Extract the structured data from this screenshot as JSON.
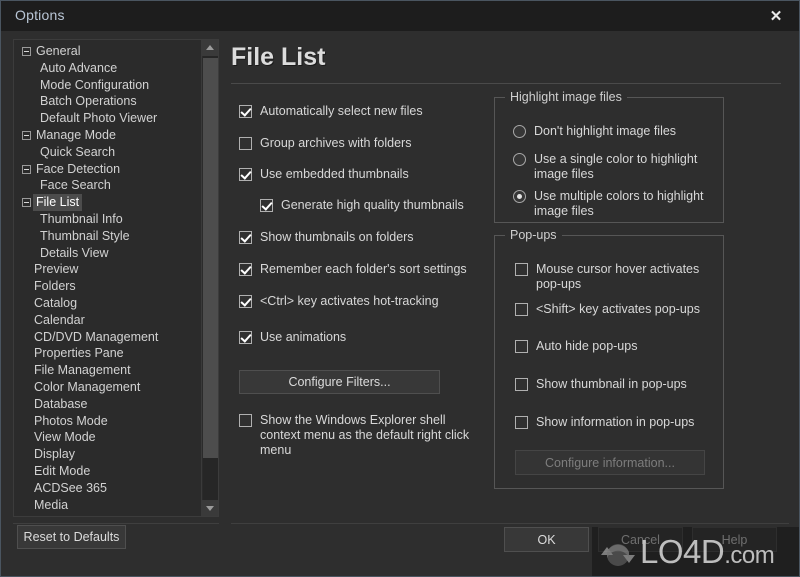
{
  "window": {
    "title": "Options",
    "close_icon": "close-icon"
  },
  "sidebar": {
    "items": [
      {
        "label": "General",
        "level": 0,
        "expandable": true,
        "selected": false
      },
      {
        "label": "Auto Advance",
        "level": 1,
        "expandable": false,
        "selected": false
      },
      {
        "label": "Mode Configuration",
        "level": 1,
        "expandable": false,
        "selected": false
      },
      {
        "label": "Batch Operations",
        "level": 1,
        "expandable": false,
        "selected": false
      },
      {
        "label": "Default Photo Viewer",
        "level": 1,
        "expandable": false,
        "selected": false
      },
      {
        "label": "Manage Mode",
        "level": 0,
        "expandable": true,
        "selected": false
      },
      {
        "label": "Quick Search",
        "level": 1,
        "expandable": false,
        "selected": false
      },
      {
        "label": "Face Detection",
        "level": 0,
        "expandable": true,
        "selected": false
      },
      {
        "label": "Face Search",
        "level": 1,
        "expandable": false,
        "selected": false
      },
      {
        "label": "File List",
        "level": 0,
        "expandable": true,
        "selected": true
      },
      {
        "label": "Thumbnail Info",
        "level": 1,
        "expandable": false,
        "selected": false
      },
      {
        "label": "Thumbnail Style",
        "level": 1,
        "expandable": false,
        "selected": false
      },
      {
        "label": "Details View",
        "level": 1,
        "expandable": false,
        "selected": false
      },
      {
        "label": "Preview",
        "level": 2,
        "expandable": false,
        "selected": false
      },
      {
        "label": "Folders",
        "level": 2,
        "expandable": false,
        "selected": false
      },
      {
        "label": "Catalog",
        "level": 2,
        "expandable": false,
        "selected": false
      },
      {
        "label": "Calendar",
        "level": 2,
        "expandable": false,
        "selected": false
      },
      {
        "label": "CD/DVD Management",
        "level": 2,
        "expandable": false,
        "selected": false
      },
      {
        "label": "Properties Pane",
        "level": 2,
        "expandable": false,
        "selected": false
      },
      {
        "label": "File Management",
        "level": 2,
        "expandable": false,
        "selected": false
      },
      {
        "label": "Color Management",
        "level": 2,
        "expandable": false,
        "selected": false
      },
      {
        "label": "Database",
        "level": 2,
        "expandable": false,
        "selected": false
      },
      {
        "label": "Photos Mode",
        "level": 2,
        "expandable": false,
        "selected": false
      },
      {
        "label": "View Mode",
        "level": 2,
        "expandable": false,
        "selected": false
      },
      {
        "label": "Display",
        "level": 2,
        "expandable": false,
        "selected": false
      },
      {
        "label": "Edit Mode",
        "level": 2,
        "expandable": false,
        "selected": false
      },
      {
        "label": "ACDSee 365",
        "level": 2,
        "expandable": false,
        "selected": false
      },
      {
        "label": "Media",
        "level": 2,
        "expandable": false,
        "selected": false
      }
    ],
    "scroll_up_icon": "chevron-up-icon",
    "scroll_down_icon": "chevron-down-icon"
  },
  "pane": {
    "title": "File List",
    "checkboxes": [
      {
        "label": "Automatically select new files",
        "accel": "w",
        "checked": true
      },
      {
        "label": "Group archives with folders",
        "accel": "G",
        "checked": false
      },
      {
        "label": "Use embedded thumbnails",
        "accel": "U",
        "checked": true
      },
      {
        "label": "Generate high quality thumbnails",
        "accel": "q",
        "checked": true
      },
      {
        "label": "Show thumbnails on folders",
        "accel": "",
        "checked": true
      },
      {
        "label": "Remember each folder's sort settings",
        "accel": "b",
        "checked": true
      },
      {
        "label": "<Ctrl> key activates hot-tracking",
        "accel": "k",
        "checked": true
      },
      {
        "label": "Use animations",
        "accel": "a",
        "checked": true
      }
    ],
    "configure_filters_label": "Configure Filters...",
    "shell_menu": {
      "label": "Show the Windows Explorer shell context menu as the default right click menu",
      "checked": false
    }
  },
  "highlight_group": {
    "title": "Highlight image files",
    "options": [
      {
        "label": "Don't highlight image files",
        "selected": false
      },
      {
        "label": "Use a single color to highlight image files",
        "selected": false
      },
      {
        "label": "Use multiple colors to highlight image files",
        "selected": true
      }
    ]
  },
  "popups_group": {
    "title": "Pop-ups",
    "checkboxes": [
      {
        "label": "Mouse cursor hover activates pop-ups",
        "checked": false
      },
      {
        "label": "<Shift> key activates pop-ups",
        "checked": false
      },
      {
        "label": "Auto hide pop-ups",
        "checked": false
      },
      {
        "label": "Show thumbnail in pop-ups",
        "checked": false
      },
      {
        "label": "Show information in pop-ups",
        "checked": false
      }
    ],
    "configure_information_label": "Configure information...",
    "configure_information_disabled": true
  },
  "footer": {
    "reset_label": "Reset to Defaults",
    "ok_label": "OK",
    "cancel_label": "Cancel",
    "help_label": "Help"
  },
  "watermark": {
    "text_main": "LO4D",
    "text_suffix": ".com"
  },
  "colors": {
    "window_bg": "#2e2e2e",
    "titlebar_bg": "#1d1d1d",
    "title_text": "#b9c6d6",
    "panel_bg": "#2b2b2b",
    "text": "#d8d8d8",
    "selection": "#4c4c4c",
    "border": "#565656"
  }
}
